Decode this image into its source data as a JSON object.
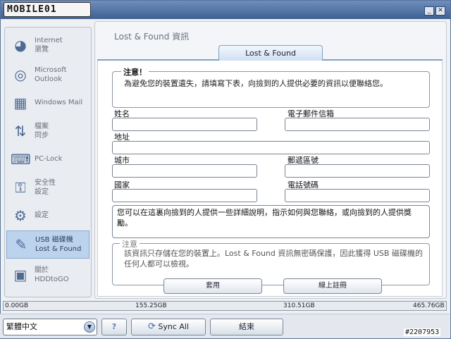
{
  "app": {
    "logo_text": "MOBILE01",
    "minimize": "_",
    "close": "✕"
  },
  "sidebar": {
    "items": [
      {
        "label": "Internet\n瀏覽",
        "icon": "globe-icon"
      },
      {
        "label": "Microsoft\nOutlook",
        "icon": "outlook-icon"
      },
      {
        "label": "Windows Mail",
        "icon": "mail-icon"
      },
      {
        "label": "檔案\n同步",
        "icon": "file-sync-icon"
      },
      {
        "label": "PC-Lock",
        "icon": "pc-lock-icon"
      },
      {
        "label": "安全性\n設定",
        "icon": "lock-icon"
      },
      {
        "label": "設定",
        "icon": "gear-icon"
      },
      {
        "label": "USB 磁碟機\nLost & Found",
        "icon": "usb-drive-icon"
      },
      {
        "label": "關於\nHDDtoGO",
        "icon": "about-icon"
      }
    ]
  },
  "main": {
    "title": "Lost & Found 資訊",
    "tab": "Lost & Found",
    "notice": {
      "title": "注意！",
      "text": "為避免您的裝置遺失，請填寫下表，向撿到的人提供必要的資訊以便聯絡您。"
    },
    "form": {
      "name_label": "姓名",
      "email_label": "電子郵件信箱",
      "address_label": "地址",
      "city_label": "城市",
      "zip_label": "郵遞區號",
      "country_label": "國家",
      "phone_label": "電話號碼",
      "info_text": "您可以在這裏向撿到的人提供一些詳細說明，指示如何與您聯絡，或向撿到的人提供獎勵。"
    },
    "note": {
      "title": "注意",
      "text": "該資訊只存儲在您的裝置上。Lost & Found 資訊無密碼保護，因此獲得 USB 磁碟機的任何人都可以檢視。"
    },
    "apply_button": "套用",
    "register_button": "線上註冊"
  },
  "capacity": {
    "labels": [
      "0.00GB",
      "155.25GB",
      "310.51GB",
      "465.76GB"
    ],
    "used_fraction": 0.0
  },
  "footer": {
    "language": "繁體中文",
    "help_icon": "?",
    "sync_all": "Sync All",
    "exit": "結束"
  },
  "watermark": "#2207953"
}
